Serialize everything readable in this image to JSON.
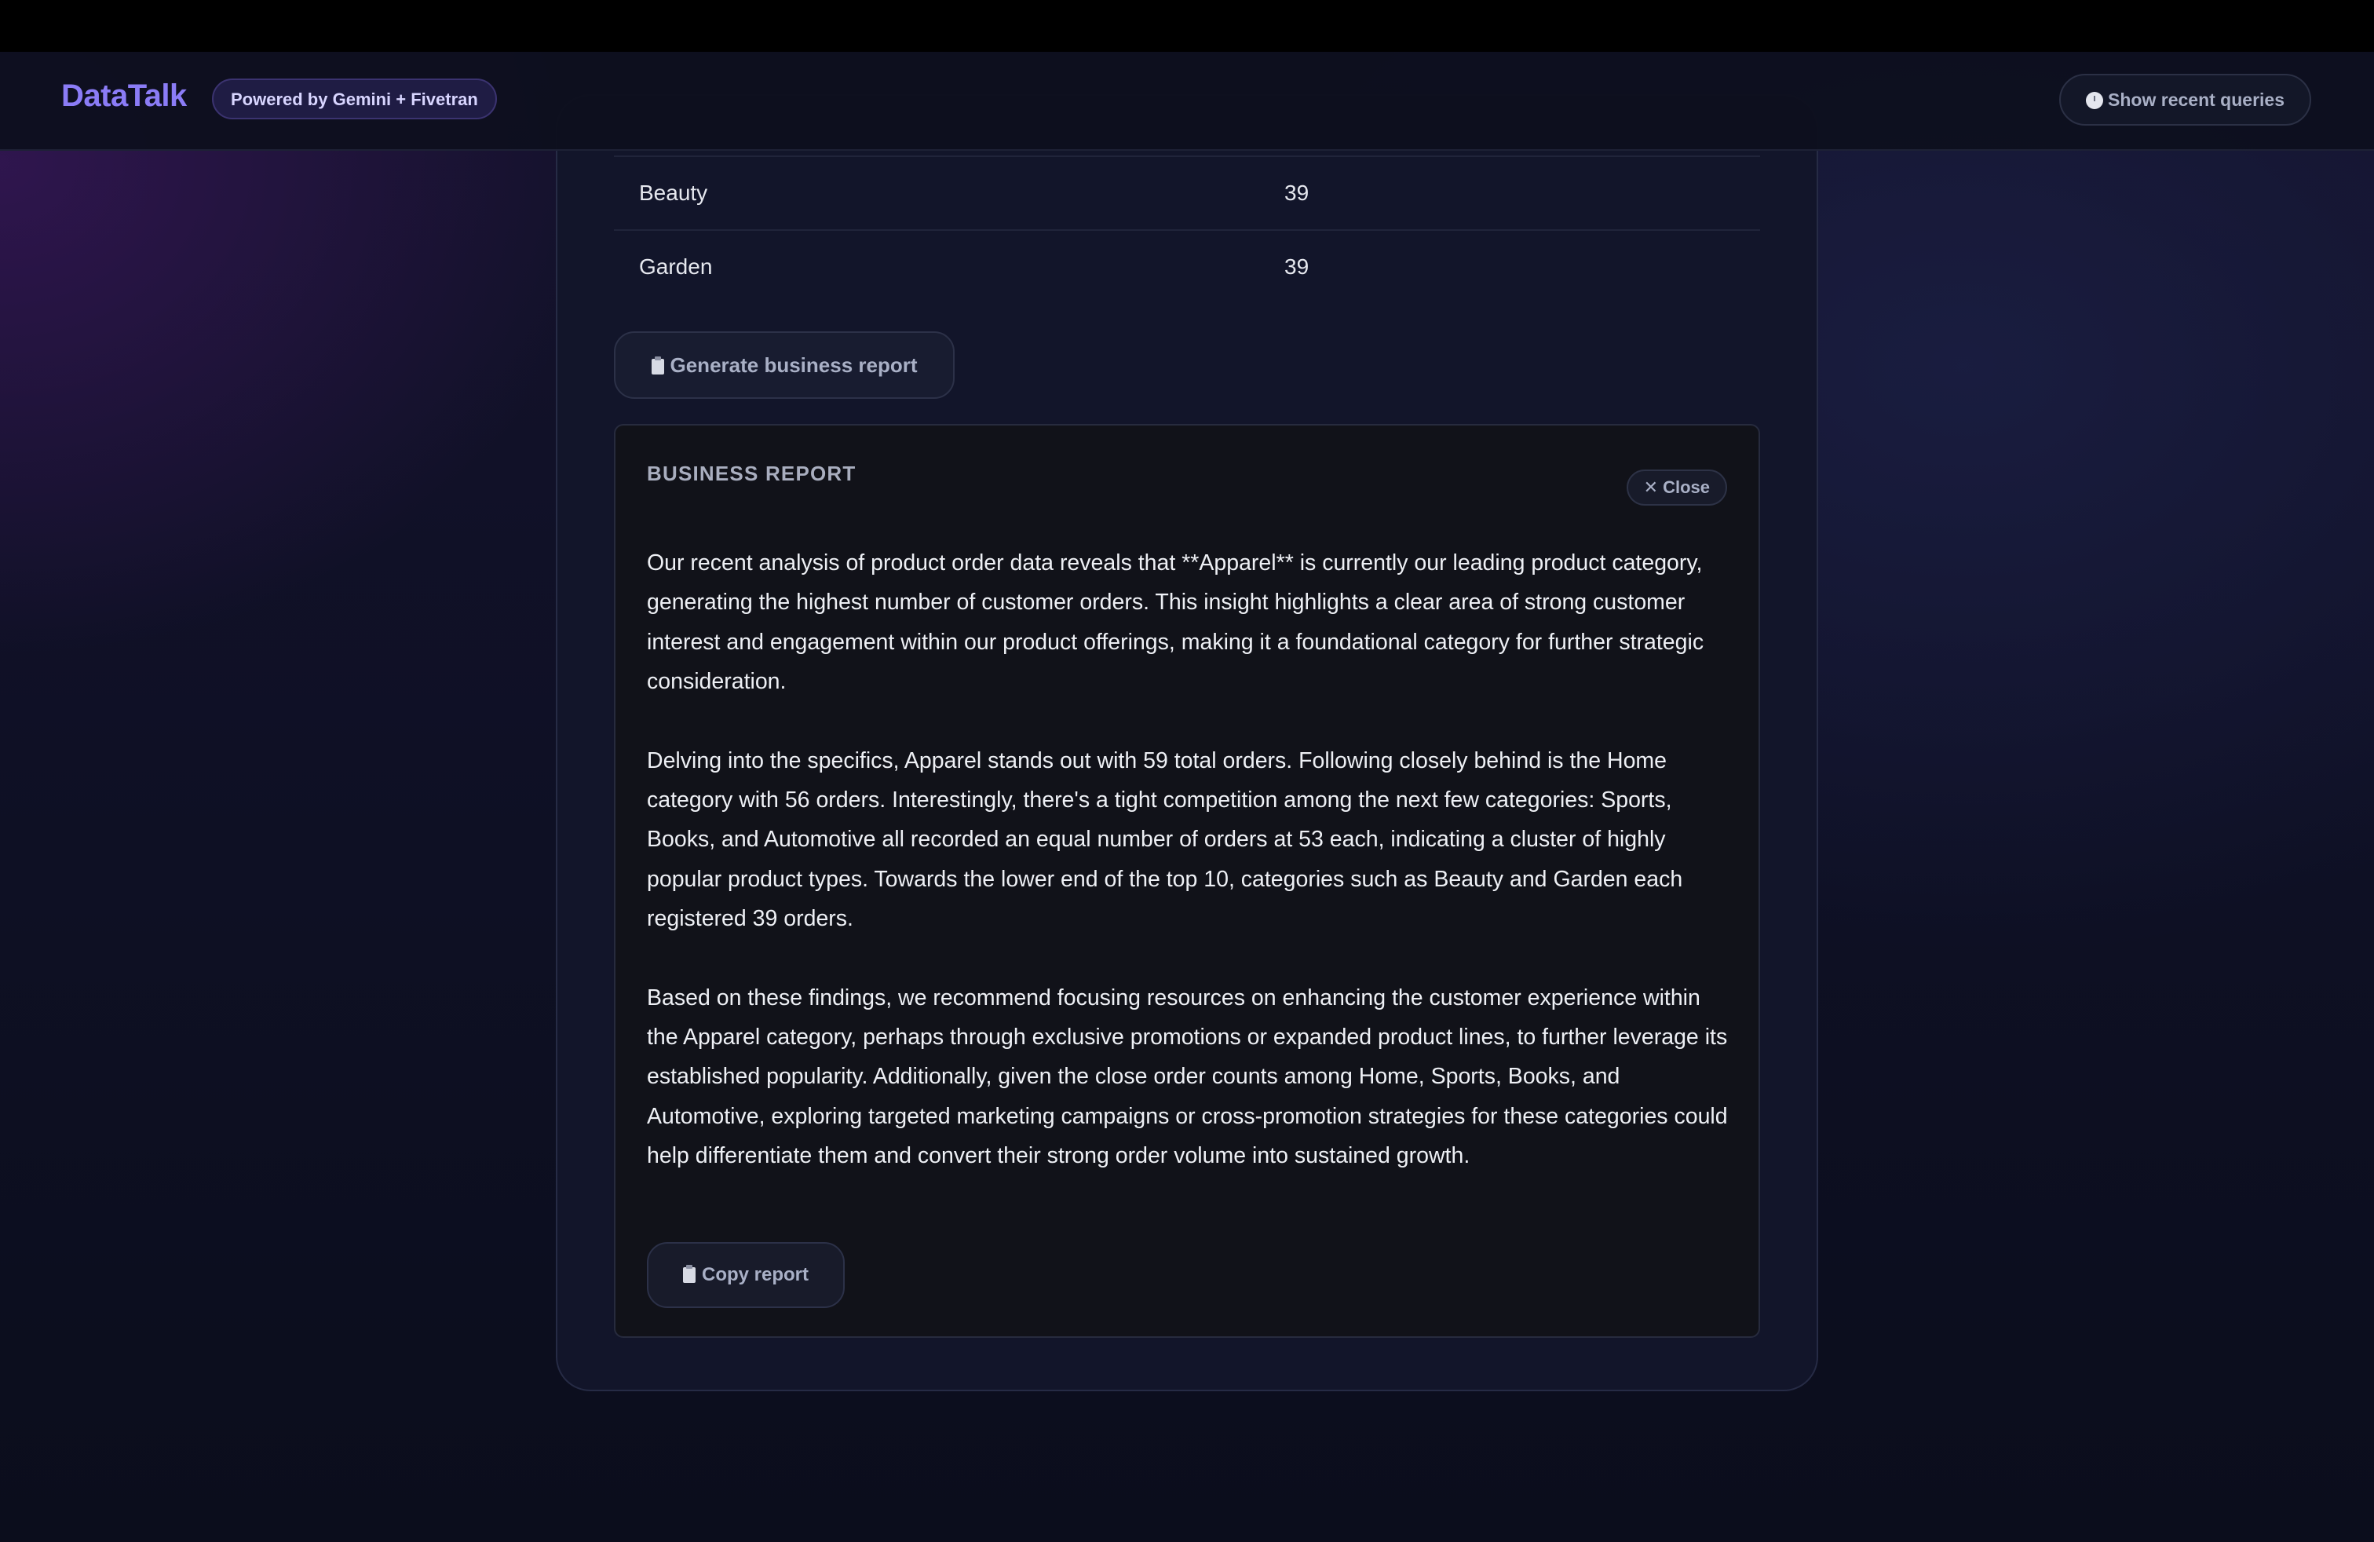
{
  "header": {
    "brand": "DataTalk",
    "badge": "Powered by Gemini + Fivetran",
    "recent_queries_label": "Show recent queries"
  },
  "results": {
    "rows": [
      {
        "category": "Beauty",
        "count": "39"
      },
      {
        "category": "Garden",
        "count": "39"
      }
    ]
  },
  "actions": {
    "generate_report_label": "Generate business report"
  },
  "report": {
    "title": "BUSINESS REPORT",
    "close_label": "Close",
    "paragraphs": [
      "Our recent analysis of product order data reveals that **Apparel** is currently our leading product category, generating the highest number of customer orders. This insight highlights a clear area of strong customer interest and engagement within our product offerings, making it a foundational category for further strategic consideration.",
      "Delving into the specifics, Apparel stands out with 59 total orders. Following closely behind is the Home category with 56 orders. Interestingly, there's a tight competition among the next few categories: Sports, Books, and Automotive all recorded an equal number of orders at 53 each, indicating a cluster of highly popular product types. Towards the lower end of the top 10, categories such as Beauty and Garden each registered 39 orders.",
      "Based on these findings, we recommend focusing resources on enhancing the customer experience within the Apparel category, perhaps through exclusive promotions or expanded product lines, to further leverage its established popularity. Additionally, given the close order counts among Home, Sports, Books, and Automotive, exploring targeted marketing campaigns or cross-promotion strategies for these categories could help differentiate them and convert their strong order volume into sustained growth."
    ],
    "copy_label": "Copy report"
  }
}
